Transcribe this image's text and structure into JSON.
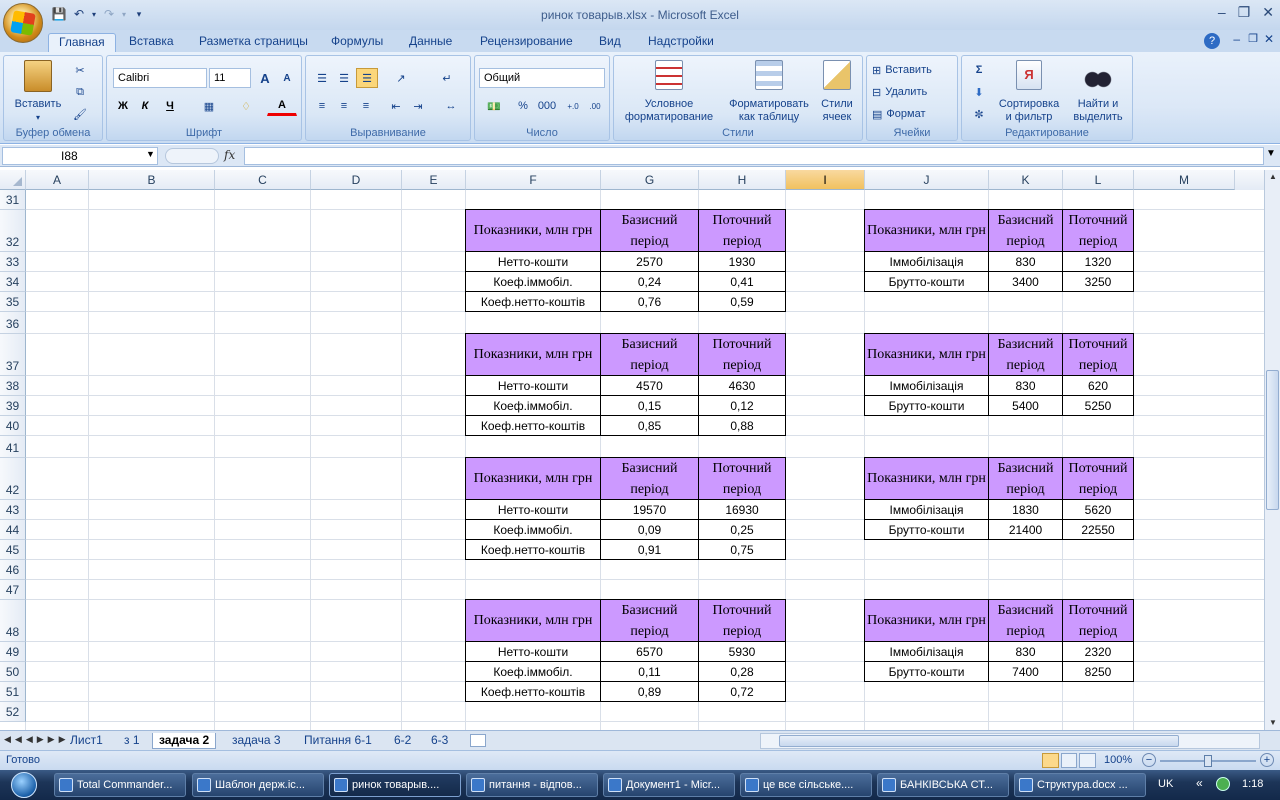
{
  "window": {
    "title": "ринок товарыв.xlsx - Microsoft Excel"
  },
  "ribbon_tabs": [
    "Главная",
    "Вставка",
    "Разметка страницы",
    "Формулы",
    "Данные",
    "Рецензирование",
    "Вид",
    "Надстройки"
  ],
  "ribbon": {
    "clipboard": {
      "label": "Буфер обмена",
      "paste": "Вставить"
    },
    "font": {
      "label": "Шрифт",
      "name": "Calibri",
      "size": "11",
      "bold": "Ж",
      "italic": "К",
      "underline": "Ч"
    },
    "alignment": {
      "label": "Выравнивание"
    },
    "number": {
      "label": "Число",
      "format": "Общий",
      "percent": "%",
      "thousands": "000"
    },
    "styles": {
      "label": "Стили",
      "cond_format_1": "Условное",
      "cond_format_2": "форматирование",
      "format_table_1": "Форматировать",
      "format_table_2": "как таблицу",
      "cell_styles_1": "Стили",
      "cell_styles_2": "ячеек"
    },
    "cells": {
      "label": "Ячейки",
      "insert": "Вставить",
      "delete": "Удалить",
      "format": "Формат"
    },
    "editing": {
      "label": "Редактирование",
      "sort_1": "Сортировка",
      "sort_2": "и фильтр",
      "find_1": "Найти и",
      "find_2": "выделить"
    }
  },
  "formula_bar": {
    "name_box": "I88",
    "fx": "fx",
    "formula": ""
  },
  "columns": [
    "A",
    "B",
    "C",
    "D",
    "E",
    "F",
    "G",
    "H",
    "I",
    "J",
    "K",
    "L",
    "M"
  ],
  "selected_column": "I",
  "rows": [
    "31",
    "32",
    "33",
    "34",
    "35",
    "36",
    "37",
    "38",
    "39",
    "40",
    "41",
    "42",
    "43",
    "44",
    "45",
    "46",
    "47",
    "48",
    "49",
    "50",
    "51",
    "52"
  ],
  "header_cells": {
    "indicators": "Показники, млн грн",
    "base": "Базисний період",
    "current": "Поточний період"
  },
  "left_tables": [
    {
      "rows": [
        [
          "Нетто-кошти",
          "2570",
          "1930"
        ],
        [
          "Коеф.іммобіл.",
          "0,24",
          "0,41"
        ],
        [
          "Коеф.нетто-коштів",
          "0,76",
          "0,59"
        ]
      ]
    },
    {
      "rows": [
        [
          "Нетто-кошти",
          "4570",
          "4630"
        ],
        [
          "Коеф.іммобіл.",
          "0,15",
          "0,12"
        ],
        [
          "Коеф.нетто-коштів",
          "0,85",
          "0,88"
        ]
      ]
    },
    {
      "rows": [
        [
          "Нетто-кошти",
          "19570",
          "16930"
        ],
        [
          "Коеф.іммобіл.",
          "0,09",
          "0,25"
        ],
        [
          "Коеф.нетто-коштів",
          "0,91",
          "0,75"
        ]
      ]
    },
    {
      "rows": [
        [
          "Нетто-кошти",
          "6570",
          "5930"
        ],
        [
          "Коеф.іммобіл.",
          "0,11",
          "0,28"
        ],
        [
          "Коеф.нетто-коштів",
          "0,89",
          "0,72"
        ]
      ]
    }
  ],
  "right_tables": [
    {
      "rows": [
        [
          "Іммобілізація",
          "830",
          "1320"
        ],
        [
          "Брутто-кошти",
          "3400",
          "3250"
        ]
      ]
    },
    {
      "rows": [
        [
          "Іммобілізація",
          "830",
          "620"
        ],
        [
          "Брутто-кошти",
          "5400",
          "5250"
        ]
      ]
    },
    {
      "rows": [
        [
          "Іммобілізація",
          "1830",
          "5620"
        ],
        [
          "Брутто-кошти",
          "21400",
          "22550"
        ]
      ]
    },
    {
      "rows": [
        [
          "Іммобілізація",
          "830",
          "2320"
        ],
        [
          "Брутто-кошти",
          "7400",
          "8250"
        ]
      ]
    }
  ],
  "sheet_tabs": [
    "Лист1",
    "з 1",
    "задача 2",
    "задача 3",
    "Питання 6-1",
    "6-2",
    "6-3"
  ],
  "active_sheet": "задача 2",
  "status": {
    "ready": "Готово",
    "zoom": "100%"
  },
  "taskbar": {
    "items": [
      "Total Commander...",
      "Шаблон держ.іс...",
      "ринок товарыв....",
      "питання - відпов...",
      "Документ1 - Micr...",
      "це все сільське....",
      "БАНКІВСЬКА СТ...",
      "Структура.docx ..."
    ],
    "active_index": 2,
    "lang": "UK",
    "time": "1:18"
  }
}
